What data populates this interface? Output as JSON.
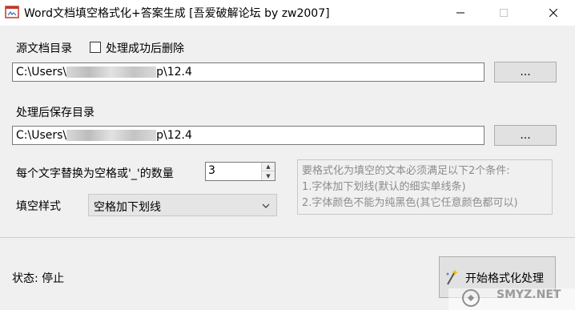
{
  "window": {
    "title": "Word文档填空格式化+答案生成 [吾爱破解论坛 by zw2007]"
  },
  "source_dir": {
    "label": "源文档目录",
    "delete_checkbox_label": "处理成功后删除",
    "delete_checked": false,
    "path_prefix": "C:\\Users\\",
    "path_suffix": "p\\12.4",
    "browse_label": "..."
  },
  "output_dir": {
    "label": "处理后保存目录",
    "path_prefix": "C:\\Users\\",
    "path_suffix": "p\\12.4",
    "browse_label": "..."
  },
  "replace_count": {
    "label": "每个文字替换为空格或'_'的数量",
    "value": "3"
  },
  "fill_style": {
    "label": "填空样式",
    "selected": "空格加下划线"
  },
  "notes": {
    "line1": "要格式化为填空的文本必须满足以下2个条件:",
    "line2": "1.字体加下划线(默认的细实单线条)",
    "line3": "2.字体颜色不能为纯黑色(其它任意颜色都可以)"
  },
  "status": {
    "text": "状态: 停止"
  },
  "start_button": {
    "label": "开始格式化处理"
  },
  "watermark": {
    "text": "SMYZ.NET"
  }
}
